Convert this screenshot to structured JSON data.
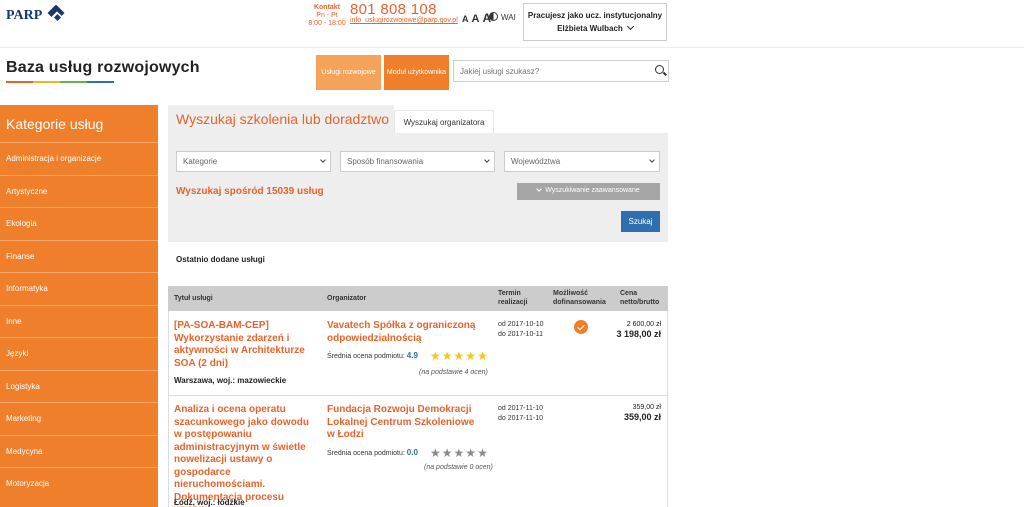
{
  "header": {
    "logo_text": "PARP",
    "contact_label": "Kontakt",
    "contact_days": "Pn - Pt",
    "contact_hours": "8:00 - 18:00",
    "phone": "801 808 108",
    "email": "info_uslugirozwojowe@parp.gov.pl",
    "font_sizes": [
      "A",
      "A",
      "A"
    ],
    "wai": "WAI",
    "user_role": "Pracujesz jako ucz. instytucjonalny",
    "user_name": "Elżbieta Wulbach"
  },
  "site_title": "Baza usług rozwojowych",
  "nav": {
    "btn1": "Usługi rozwojowe",
    "btn2": "Moduł użytkownika",
    "search_placeholder": "Jakiej usługi szukasz?"
  },
  "sidebar": {
    "title": "Kategorie usług",
    "items": [
      "Administracja i organizacje",
      "Artystyczne",
      "Ekologia",
      "Finanse",
      "Informatyka",
      "Inne",
      "Języki",
      "Logistyka",
      "Marketing",
      "Medycyna",
      "Motoryzacja"
    ]
  },
  "search_panel": {
    "tab_active": "Wyszukaj szkolenia lub doradztwo",
    "tab_other": "Wyszukaj organizatora",
    "select_category": "Kategorie",
    "select_funding": "Sposób finansowania",
    "select_region": "Województwa",
    "found_prefix": "Wyszukaj spośród",
    "found_count": "15039",
    "found_suffix": "usług",
    "advanced": "Wyszukiwanie zaawansowane",
    "search_btn": "Szukaj"
  },
  "recent_title": "Ostatnio dodane usługi",
  "table": {
    "headers": {
      "title": "Tytuł usługi",
      "organizer": "Organizator",
      "term": "Termin realizacji",
      "funding": "Możliwość dofinansowania",
      "price": "Cena netto/brutto"
    },
    "rows": [
      {
        "title": "[PA-SOA-BAM-CEP] Wykorzystanie zdarzeń i aktywności w Architekturze SOA (2 dni)",
        "location": "Warszawa, woj.: mazowieckie",
        "organizer": "Vavatech Spółka z ograniczoną odpowiedzialnością",
        "rating_label": "Średnia ocena podmiotu:",
        "rating": "4.9",
        "stars_filled": 5,
        "rating_count": "(na podstawie 4 ocen)",
        "date_from": "od 2017-10-10",
        "date_to": "do 2017-10-11",
        "funding": true,
        "price_net": "2 600,00 zł",
        "price_gross": "3 198,00 zł"
      },
      {
        "title": "Analiza i ocena operatu szacunkowego jako dowodu w postępowaniu administracyjnym w świetle nowelizacji ustawy o gospodarce nieruchomościami. Dokumentacja procesu wyceny",
        "location": "Łódź, woj.: łódzkie",
        "organizer": "Fundacja Rozwoju Demokracji Lokalnej Centrum Szkoleniowe w Łodzi",
        "rating_label": "Średnia ocena podmiotu:",
        "rating": "0.0",
        "stars_filled": 0,
        "rating_count": "(na podstawie 0 ocen)",
        "date_from": "od 2017-11-10",
        "date_to": "do 2017-11-10",
        "funding": false,
        "price_net": "359,00 zł",
        "price_gross": "359,00 zł"
      }
    ]
  },
  "colors": {
    "accent": "#f07f2c",
    "link": "#e8632b",
    "primary_btn": "#2f6fb0",
    "star_on": "#f5c518",
    "star_off": "#8a8a8a"
  }
}
